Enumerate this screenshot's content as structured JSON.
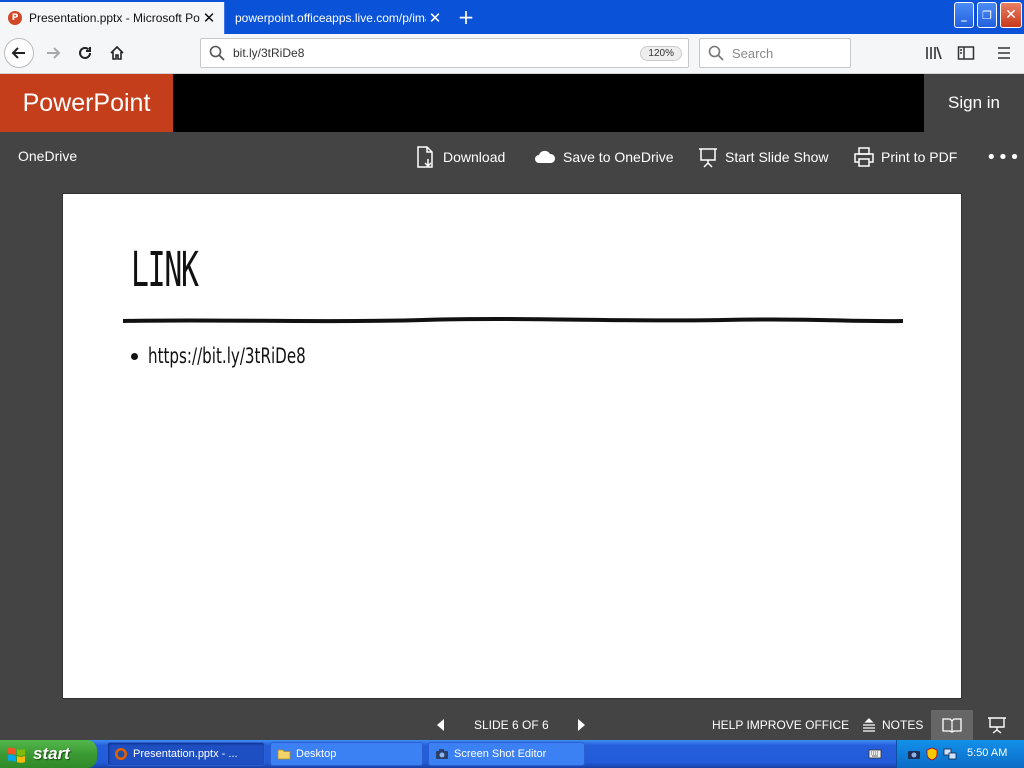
{
  "browser": {
    "tabs": [
      {
        "title": "Presentation.pptx - Microsoft PowerPoint Online",
        "favicon_letter": "P",
        "active": true
      },
      {
        "title": "powerpoint.officeapps.live.com/p/imag",
        "active": false
      }
    ],
    "url": "bit.ly/3tRiDe8",
    "zoom": "120%",
    "search_placeholder": "Search"
  },
  "office": {
    "brand": "PowerPoint",
    "sign_in": "Sign in",
    "brand_color": "#c43e1c"
  },
  "commands": {
    "onedrive": "OneDrive",
    "download": "Download",
    "save_to_onedrive": "Save to OneDrive",
    "start_slide_show": "Start Slide Show",
    "print_to_pdf": "Print to PDF",
    "more": "•••"
  },
  "slide": {
    "title": "LINK",
    "bullets": [
      "https://bit.ly/3tRiDe8"
    ]
  },
  "statusbar": {
    "slide_indicator": "SLIDE 6 OF 6",
    "help_improve": "HELP IMPROVE OFFICE",
    "notes": "NOTES"
  },
  "taskbar": {
    "start": "start",
    "tasks": [
      {
        "label": "Presentation.pptx - ...",
        "active": true
      },
      {
        "label": "Desktop",
        "active": false
      },
      {
        "label": "Screen Shot Editor",
        "active": false
      }
    ],
    "clock": "5:50 AM"
  }
}
